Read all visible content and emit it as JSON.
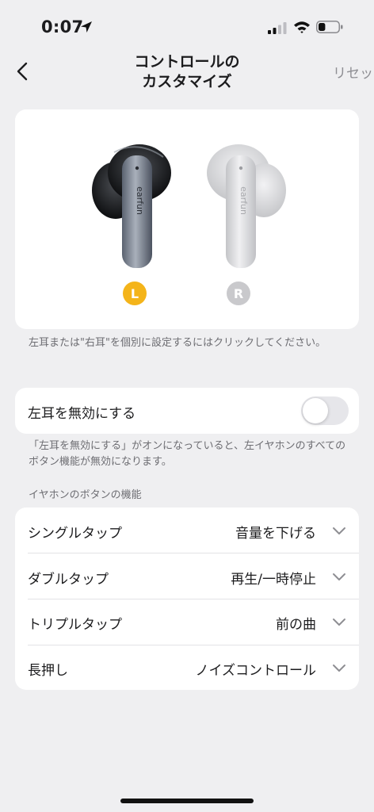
{
  "status_bar": {
    "time": "0:07",
    "battery_level": 0.35
  },
  "header": {
    "title_line1": "コントロールの",
    "title_line2": "カスタマイズ",
    "reset_label": "リセット"
  },
  "earbuds": {
    "left_label": "L",
    "right_label": "R",
    "left_color": "#f4b41a",
    "right_color": "#c9c9cc",
    "brand_text": "earfun",
    "hint": "左耳または\"右耳\"を個別に設定するにはクリックしてください。"
  },
  "disable": {
    "label": "左耳を無効にする",
    "enabled": false,
    "hint": "「左耳を無効にする」がオンになっていると、左イヤホンのすべてのボタン機能が無効になります。"
  },
  "functions": {
    "section_title": "イヤホンのボタンの機能",
    "rows": [
      {
        "label": "シングルタップ",
        "value": "音量を下げる"
      },
      {
        "label": "ダブルタップ",
        "value": "再生/一時停止"
      },
      {
        "label": "トリプルタップ",
        "value": "前の曲"
      },
      {
        "label": "長押し",
        "value": "ノイズコントロール"
      }
    ]
  }
}
